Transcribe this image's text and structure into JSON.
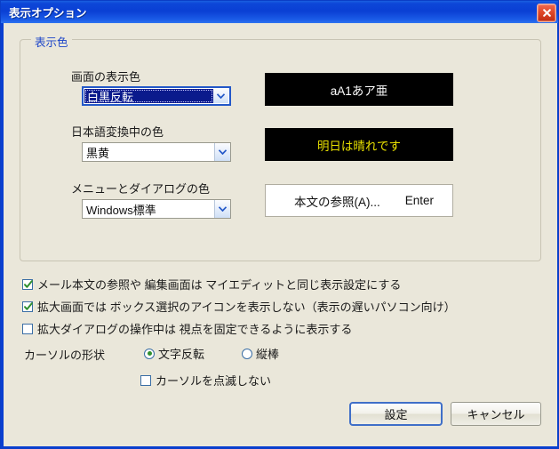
{
  "window": {
    "title": "表示オプション",
    "close_icon": "close-icon"
  },
  "groupbox": {
    "legend": "表示色",
    "fields": [
      {
        "label": "画面の表示色",
        "value": "白黒反転",
        "focused": true,
        "preview_text": "aA1あア亜",
        "preview_style": "black-on-white-inverted"
      },
      {
        "label": "日本語変換中の色",
        "value": "黒黄",
        "focused": false,
        "preview_text": "明日は晴れです",
        "preview_style": "yellow-on-black"
      },
      {
        "label": "メニューとダイアログの色",
        "value": "Windows標準",
        "focused": false,
        "preview_text": "本文の参照(A)...",
        "preview_accel": "Enter",
        "preview_style": "windows-default-menu"
      }
    ]
  },
  "options": {
    "checkboxes": [
      {
        "label": "メール本文の参照や 編集画面は マイエディットと同じ表示設定にする",
        "checked": true
      },
      {
        "label": "拡大画面では ボックス選択のアイコンを表示しない（表示の遅いパソコン向け）",
        "checked": true
      },
      {
        "label": "拡大ダイアログの操作中は 視点を固定できるように表示する",
        "checked": false
      }
    ]
  },
  "cursor": {
    "label": "カーソルの形状",
    "radios": [
      {
        "label": "文字反転",
        "selected": true
      },
      {
        "label": "縦棒",
        "selected": false
      }
    ],
    "no_blink": {
      "label": "カーソルを点滅しない",
      "checked": false
    }
  },
  "buttons": {
    "ok": "設定",
    "cancel": "キャンセル"
  },
  "colors": {
    "titlebar_blue": "#0a3fd4",
    "dialog_bg": "#eae7da",
    "legend_blue": "#1b44c8",
    "preview_bg": "#000000",
    "preview_yellow": "#e8e000",
    "check_green": "#2f8f2f",
    "focus_navy": "#0a1a8c"
  }
}
